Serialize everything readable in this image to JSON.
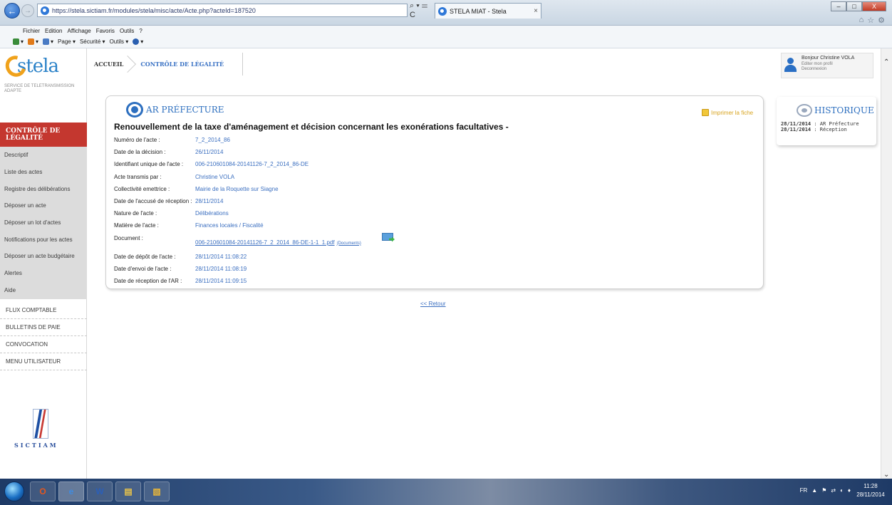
{
  "browser": {
    "url": "https://stela.sictiam.fr/modules/stela/misc/acte/Acte.php?acteId=187520",
    "tab_title": "STELA MIAT - Stela",
    "tab_close": "×",
    "address_tools": "⌕ ▾ ☰ C",
    "menu_items": [
      "Fichier",
      "Edition",
      "Affichage",
      "Favoris",
      "Outils",
      "?"
    ],
    "commands": [
      {
        "label": "▾",
        "color": "#3a8c3a"
      },
      {
        "label": "▾",
        "color": "#e07a1a"
      },
      {
        "label": "▾",
        "color": "#4a7bc4"
      },
      {
        "label": "Page ▾",
        "color": ""
      },
      {
        "label": "Sécurité ▾",
        "color": ""
      },
      {
        "label": "Outils ▾",
        "color": ""
      },
      {
        "label": "▾",
        "color": "#2a5fb0"
      }
    ],
    "window_buttons": {
      "minimize": "–",
      "maximize": "□",
      "close": "X"
    },
    "right_icons": [
      "⌂",
      "☆",
      "⚙"
    ]
  },
  "sidebar": {
    "logo_text": "stela",
    "logo_subtitle": "SERVICE DE TELETRANSMISSION ADAPTE",
    "active_section": "CONTRÔLE DE LÉGALITÉ",
    "subnav": [
      "Descriptif",
      "Liste des actes",
      "Registre des délibérations",
      "Déposer un acte",
      "Déposer un lot d'actes",
      "Notifications pour les actes",
      "Déposer un acte budgétaire",
      "Alertes",
      "Aide"
    ],
    "sections": [
      "FLUX COMPTABLE",
      "BULLETINS DE PAIE",
      "CONVOCATION",
      "MENU UTILISATEUR"
    ],
    "partner_name": "SICTIAM"
  },
  "breadcrumb": {
    "home": "ACCUEIL",
    "current": "CONTRÔLE DE LÉGALITÉ"
  },
  "user": {
    "greeting": "Bonjour Christine VOLA",
    "edit_profile": "Editer mon profil",
    "logout": "Deconnexion"
  },
  "card": {
    "heading": "AR PRÉFECTURE",
    "print_label": "Imprimer la fiche",
    "act_title": "Renouvellement de la taxe d'aménagement et décision concernant les exonérations facultatives -",
    "fields": [
      {
        "label": "Numéro de l'acte :",
        "value": "7_2_2014_86"
      },
      {
        "label": "Date de la décision :",
        "value": "26/11/2014"
      },
      {
        "label": "Identifiant unique de l'acte :",
        "value": "006-210601084-20141126-7_2_2014_86-DE"
      },
      {
        "label": "Acte transmis par :",
        "value": "Christine VOLA"
      },
      {
        "label": "Collectivité emettrice :",
        "value": "Mairie de la Roquette sur Siagne"
      },
      {
        "label": "Date de l'accusé de réception :",
        "value": "28/11/2014"
      },
      {
        "label": "Nature de l'acte :",
        "value": "Délibérations"
      },
      {
        "label": "Matière de l'acte :",
        "value": "Finances locales / Fiscalité"
      }
    ],
    "document": {
      "label": "Document :",
      "filename": "006-210601084-20141126-7_2_2014_86-DE-1-1_1.pdf",
      "description": "(Documents)"
    },
    "dates": [
      {
        "label": "Date de dépôt de l'acte :",
        "value": "28/11/2014 11:08:22"
      },
      {
        "label": "Date d'envoi de l'acte :",
        "value": "28/11/2014 11:08:19"
      },
      {
        "label": "Date de réception de l'AR :",
        "value": "28/11/2014 11:09:15"
      }
    ]
  },
  "return_link": "<< Retour",
  "history": {
    "heading": "HISTORIQUE",
    "entries": [
      {
        "date": "28/11/2014",
        "event": " : AR Préfecture"
      },
      {
        "date": "28/11/2014",
        "event": " : Réception"
      }
    ]
  },
  "taskbar": {
    "apps": [
      {
        "label": "O",
        "color": "#e4571e"
      },
      {
        "label": "e",
        "color": "#3f8be0"
      },
      {
        "label": "W",
        "color": "#2b5fb8"
      },
      {
        "label": "▤",
        "color": "#e8c24a"
      },
      {
        "label": "▧",
        "color": "#e6b53a"
      }
    ],
    "tray": [
      "FR",
      "▲",
      "⚑",
      "⇄",
      "◐",
      "♦"
    ],
    "time": "11:28",
    "date": "28/11/2014"
  }
}
